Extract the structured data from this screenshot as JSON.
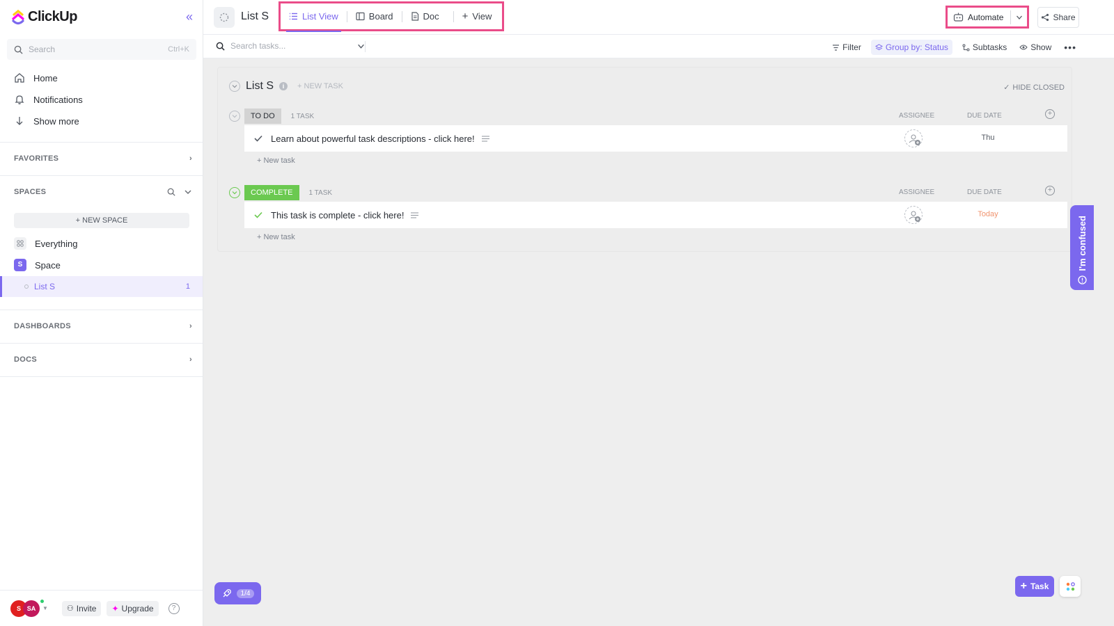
{
  "sidebar": {
    "logo_text": "ClickUp",
    "search_placeholder": "Search",
    "search_shortcut": "Ctrl+K",
    "nav": [
      {
        "label": "Home",
        "icon": "home-icon"
      },
      {
        "label": "Notifications",
        "icon": "bell-icon"
      },
      {
        "label": "Show more",
        "icon": "arrow-down-icon"
      }
    ],
    "favorites_label": "FAVORITES",
    "spaces_label": "SPACES",
    "new_space_label": "NEW SPACE",
    "everything_label": "Everything",
    "space_label": "Space",
    "space_badge": "S",
    "list_label": "List S",
    "list_count": "1",
    "dashboards_label": "DASHBOARDS",
    "docs_label": "DOCS",
    "avatar1": "S",
    "avatar2": "SA",
    "invite_label": "Invite",
    "upgrade_label": "Upgrade"
  },
  "topbar": {
    "list_title": "List S",
    "tabs": [
      {
        "label": "List View",
        "icon": "list-icon",
        "active": true
      },
      {
        "label": "Board",
        "icon": "board-icon"
      },
      {
        "label": "Doc",
        "icon": "doc-icon"
      },
      {
        "label": "View",
        "icon": "plus-icon"
      }
    ],
    "automate_label": "Automate",
    "share_label": "Share"
  },
  "toolbar": {
    "search_placeholder": "Search tasks...",
    "filter_label": "Filter",
    "group_label": "Group by: Status",
    "subtasks_label": "Subtasks",
    "show_label": "Show"
  },
  "list": {
    "name": "List S",
    "new_task_label": "+ NEW TASK",
    "hide_closed_label": "HIDE CLOSED",
    "assignee_col": "ASSIGNEE",
    "due_col": "DUE DATE",
    "new_task_line": "+ New task",
    "groups": [
      {
        "status": "TO DO",
        "count": "1 TASK",
        "status_color": "#d3d3d3",
        "task": {
          "name": "Learn about powerful task descriptions - click here!",
          "due": "Thu"
        }
      },
      {
        "status": "COMPLETE",
        "count": "1 TASK",
        "status_color": "#6bc950",
        "task": {
          "name": "This task is complete - click here!",
          "due": "Today"
        }
      }
    ]
  },
  "floaters": {
    "confused_label": "I'm confused",
    "progress_label": "1/4",
    "task_button_label": "Task"
  },
  "colors": {
    "accent": "#7b68ee",
    "highlight": "#ea4c89"
  }
}
